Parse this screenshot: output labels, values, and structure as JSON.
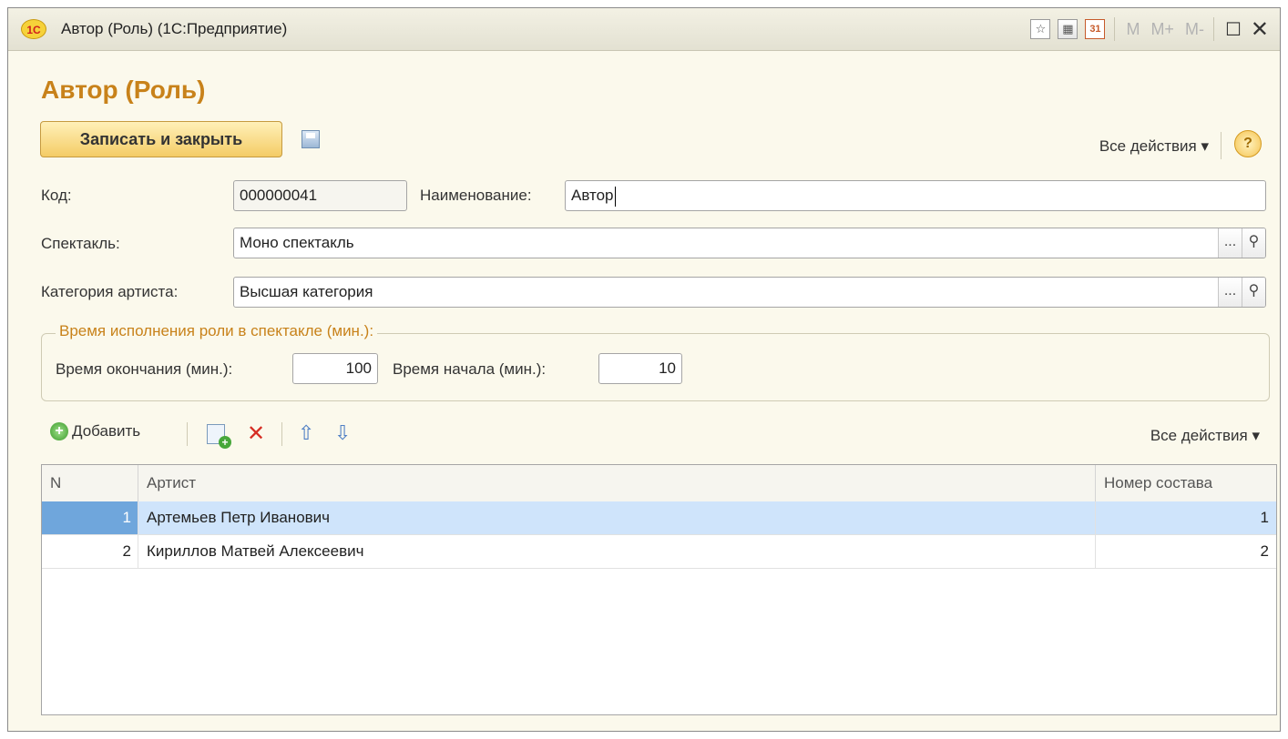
{
  "window": {
    "title": "Автор (Роль)  (1С:Предприятие)",
    "logo_text": "1С",
    "toolbar_m_labels": [
      "M",
      "M+",
      "M-"
    ],
    "calendar_text": "31"
  },
  "form": {
    "heading": "Автор (Роль)",
    "save_close_label": "Записать и закрыть",
    "all_actions_label": "Все действия ▾",
    "help_label": "?",
    "code_label": "Код:",
    "code_value": "000000041",
    "name_label": "Наименование:",
    "name_value": "Автор",
    "show_label": "Спектакль:",
    "show_value": "Моно спектакль",
    "category_label": "Категория артиста:",
    "category_value": "Высшая категория",
    "select_button": "...",
    "group_title": "Время исполнения роли в спектакле (мин.):",
    "end_time_label": "Время окончания (мин.):",
    "end_time_value": "100",
    "start_time_label": "Время начала (мин.):",
    "start_time_value": "10"
  },
  "table_toolbar": {
    "add_label": "Добавить",
    "all_actions_label": "Все действия ▾"
  },
  "table": {
    "columns": [
      "N",
      "Артист",
      "Номер состава"
    ],
    "rows": [
      {
        "n": "1",
        "artist": "Артемьев Петр Иванович",
        "cast": "1",
        "selected": true
      },
      {
        "n": "2",
        "artist": "Кириллов Матвей Алексеевич",
        "cast": "2",
        "selected": false
      }
    ]
  },
  "colors": {
    "accent": "#c8821a",
    "window_bg": "#fbf9ec",
    "selected_row": "#cfe4fb",
    "selected_cell": "#6fa6dc"
  }
}
